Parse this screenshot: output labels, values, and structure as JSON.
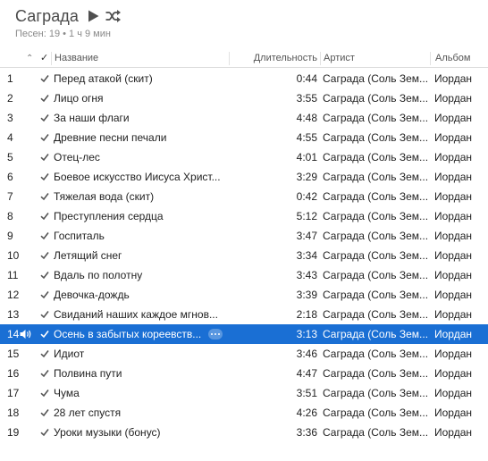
{
  "playlist": {
    "title": "Саграда",
    "subtitle": "Песен: 19 • 1 ч 9 мин"
  },
  "columns": {
    "sort_indicator": "⌃",
    "check": "✓",
    "name": "Название",
    "duration": "Длительность",
    "artist": "Артист",
    "album": "Альбом"
  },
  "icons": {
    "play": "play-icon",
    "shuffle": "shuffle-icon",
    "checkbox": "checkmark-icon",
    "now_playing": "speaker-icon",
    "more": "more-icon"
  },
  "colors": {
    "selection": "#1a6fd4",
    "title": "#4a4a4a",
    "subtitle": "#8a8a8a"
  },
  "selected_index": 13,
  "tracks": [
    {
      "num": "1",
      "name": "Перед атакой (скит)",
      "duration": "0:44",
      "artist": "Саграда (Соль Зем...",
      "album": "Иордан"
    },
    {
      "num": "2",
      "name": "Лицо огня",
      "duration": "3:55",
      "artist": "Саграда (Соль Зем...",
      "album": "Иордан"
    },
    {
      "num": "3",
      "name": "За наши флаги",
      "duration": "4:48",
      "artist": "Саграда (Соль Зем...",
      "album": "Иордан"
    },
    {
      "num": "4",
      "name": "Древние песни печали",
      "duration": "4:55",
      "artist": "Саграда (Соль Зем...",
      "album": "Иордан"
    },
    {
      "num": "5",
      "name": "Отец-лес",
      "duration": "4:01",
      "artist": "Саграда (Соль Зем...",
      "album": "Иордан"
    },
    {
      "num": "6",
      "name": "Боевое искусство Иисуса Христ...",
      "duration": "3:29",
      "artist": "Саграда (Соль Зем...",
      "album": "Иордан"
    },
    {
      "num": "7",
      "name": "Тяжелая вода (скит)",
      "duration": "0:42",
      "artist": "Саграда (Соль Зем...",
      "album": "Иордан"
    },
    {
      "num": "8",
      "name": "Преступления сердца",
      "duration": "5:12",
      "artist": "Саграда (Соль Зем...",
      "album": "Иордан"
    },
    {
      "num": "9",
      "name": "Госпиталь",
      "duration": "3:47",
      "artist": "Саграда (Соль Зем...",
      "album": "Иордан"
    },
    {
      "num": "10",
      "name": "Летящий снег",
      "duration": "3:34",
      "artist": "Саграда (Соль Зем...",
      "album": "Иордан"
    },
    {
      "num": "11",
      "name": "Вдаль по полотну",
      "duration": "3:43",
      "artist": "Саграда (Соль Зем...",
      "album": "Иордан"
    },
    {
      "num": "12",
      "name": "Девочка-дождь",
      "duration": "3:39",
      "artist": "Саграда (Соль Зем...",
      "album": "Иордан"
    },
    {
      "num": "13",
      "name": "Свиданий наших каждое мгнов...",
      "duration": "2:18",
      "artist": "Саграда (Соль Зем...",
      "album": "Иордан"
    },
    {
      "num": "14",
      "name": "Осень в забытых кореевств...",
      "duration": "3:13",
      "artist": "Саграда (Соль Зем...",
      "album": "Иордан"
    },
    {
      "num": "15",
      "name": "Идиот",
      "duration": "3:46",
      "artist": "Саграда (Соль Зем...",
      "album": "Иордан"
    },
    {
      "num": "16",
      "name": "Полвина пути",
      "duration": "4:47",
      "artist": "Саграда (Соль Зем...",
      "album": "Иордан"
    },
    {
      "num": "17",
      "name": "Чума",
      "duration": "3:51",
      "artist": "Саграда (Соль Зем...",
      "album": "Иордан"
    },
    {
      "num": "18",
      "name": "28 лет спустя",
      "duration": "4:26",
      "artist": "Саграда (Соль Зем...",
      "album": "Иордан"
    },
    {
      "num": "19",
      "name": "Уроки музыки (бонус)",
      "duration": "3:36",
      "artist": "Саграда (Соль Зем...",
      "album": "Иордан"
    }
  ]
}
